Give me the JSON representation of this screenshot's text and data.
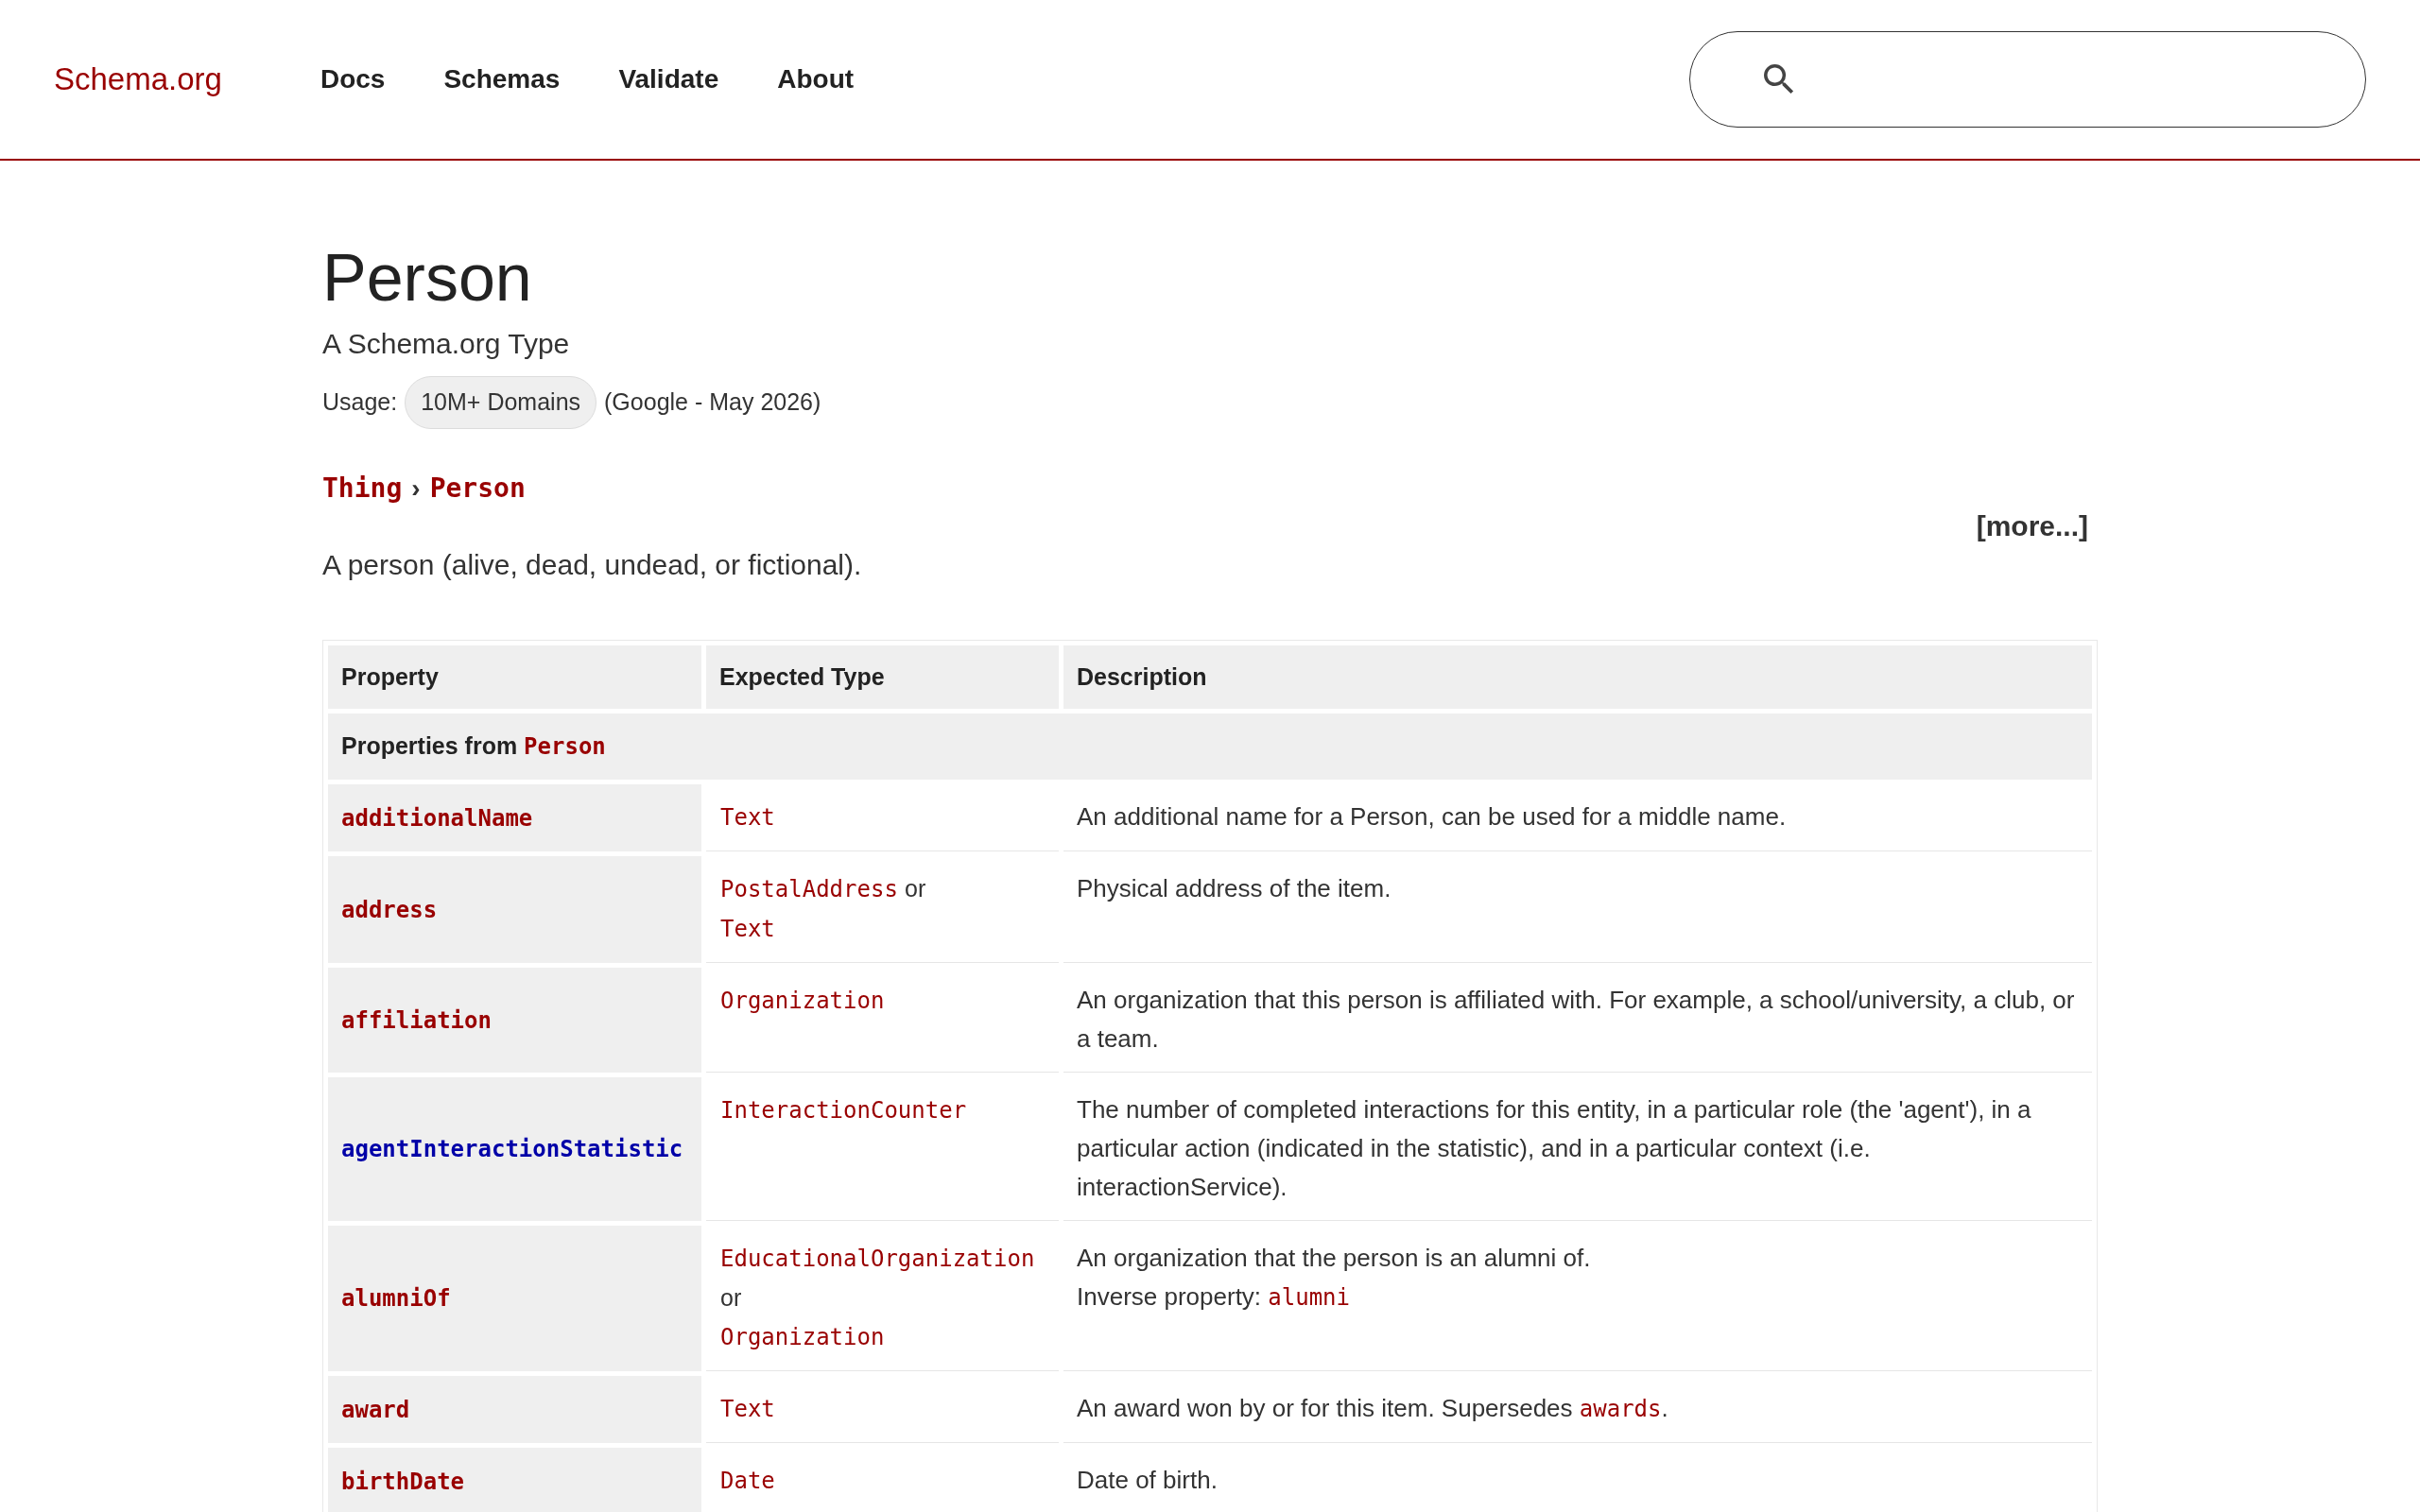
{
  "header": {
    "logo": "Schema.org",
    "nav": [
      {
        "label": "Docs"
      },
      {
        "label": "Schemas"
      },
      {
        "label": "Validate"
      },
      {
        "label": "About"
      }
    ]
  },
  "page": {
    "title": "Person",
    "subtitle": "A Schema.org Type",
    "usage": {
      "label": "Usage:",
      "badge": "10M+ Domains",
      "source": "(Google - May 2026)"
    },
    "breadcrumb": {
      "items": [
        "Thing",
        "Person"
      ],
      "separator": "›"
    },
    "more_link": "[more...]",
    "description": "A person (alive, dead, undead, or fictional)."
  },
  "table": {
    "columns": [
      "Property",
      "Expected Type",
      "Description"
    ],
    "sections": [
      {
        "label": "Properties from ",
        "type": "Person",
        "rows": [
          {
            "property": "additionalName",
            "pending": false,
            "types": [
              {
                "name": "Text"
              }
            ],
            "description": [
              [
                {
                  "kind": "text",
                  "text": "An additional name for a Person, can be used for a middle name."
                }
              ]
            ]
          },
          {
            "property": "address",
            "pending": false,
            "types": [
              {
                "name": "PostalAddress",
                "joiner": "or"
              },
              {
                "name": "Text"
              }
            ],
            "description": [
              [
                {
                  "kind": "text",
                  "text": "Physical address of the item."
                }
              ]
            ]
          },
          {
            "property": "affiliation",
            "pending": false,
            "types": [
              {
                "name": "Organization"
              }
            ],
            "description": [
              [
                {
                  "kind": "text",
                  "text": "An organization that this person is affiliated with. For example, a school/university, a club, or a team."
                }
              ]
            ]
          },
          {
            "property": "agentInteractionStatistic",
            "pending": true,
            "types": [
              {
                "name": "InteractionCounter"
              }
            ],
            "description": [
              [
                {
                  "kind": "text",
                  "text": "The number of completed interactions for this entity, in a particular role (the 'agent'), in a particular action (indicated in the statistic), and in a particular context (i.e. interactionService)."
                }
              ]
            ]
          },
          {
            "property": "alumniOf",
            "pending": false,
            "types": [
              {
                "name": "EducationalOrganization",
                "joiner": "or"
              },
              {
                "name": "Organization"
              }
            ],
            "description": [
              [
                {
                  "kind": "text",
                  "text": "An organization that the person is an alumni of."
                }
              ],
              [
                {
                  "kind": "text",
                  "text": "Inverse property: "
                },
                {
                  "kind": "link",
                  "text": "alumni"
                }
              ]
            ]
          },
          {
            "property": "award",
            "pending": false,
            "types": [
              {
                "name": "Text"
              }
            ],
            "description": [
              [
                {
                  "kind": "text",
                  "text": "An award won by or for this item. Supersedes "
                },
                {
                  "kind": "link",
                  "text": "awards"
                },
                {
                  "kind": "text",
                  "text": "."
                }
              ]
            ]
          },
          {
            "property": "birthDate",
            "pending": false,
            "types": [
              {
                "name": "Date"
              }
            ],
            "description": [
              [
                {
                  "kind": "text",
                  "text": "Date of birth."
                }
              ]
            ]
          }
        ]
      }
    ]
  }
}
